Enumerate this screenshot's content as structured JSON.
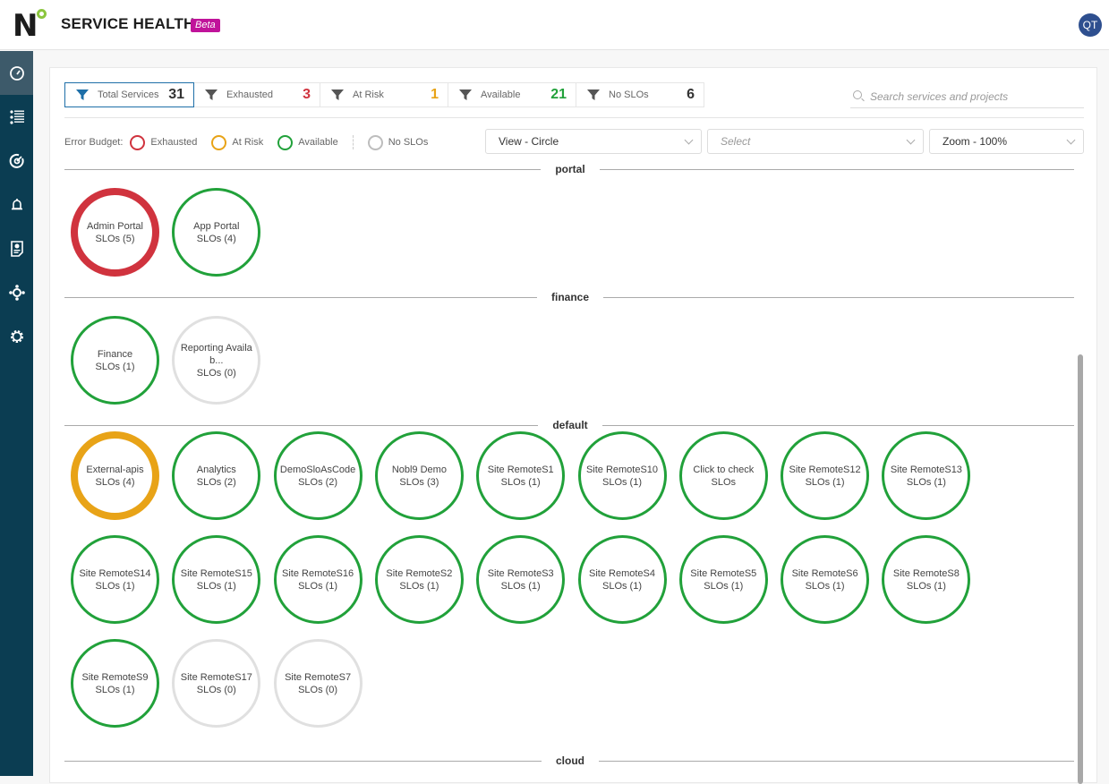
{
  "header": {
    "app_title": "SERVICE HEALTH",
    "badge": "Beta",
    "avatar_initials": "QT"
  },
  "sidebar": {
    "items": [
      {
        "name": "dashboard",
        "icon": "speedometer-icon",
        "active": true
      },
      {
        "name": "catalog",
        "icon": "list-icon",
        "active": false
      },
      {
        "name": "slo",
        "icon": "target-icon",
        "active": false
      },
      {
        "name": "alerts",
        "icon": "bell-icon",
        "active": false
      },
      {
        "name": "reports",
        "icon": "report-icon",
        "active": false
      },
      {
        "name": "integrations",
        "icon": "integrations-icon",
        "active": false
      },
      {
        "name": "settings",
        "icon": "gear-icon",
        "active": false
      }
    ]
  },
  "stats": [
    {
      "label": "Total Services",
      "count": "31",
      "color": "#333333",
      "selected": true
    },
    {
      "label": "Exhausted",
      "count": "3",
      "color": "#d0333e",
      "selected": false
    },
    {
      "label": "At Risk",
      "count": "1",
      "color": "#e8a317",
      "selected": false
    },
    {
      "label": "Available",
      "count": "21",
      "color": "#21a13a",
      "selected": false
    },
    {
      "label": "No SLOs",
      "count": "6",
      "color": "#333333",
      "selected": false
    }
  ],
  "search": {
    "placeholder": "Search services and projects",
    "value": ""
  },
  "legend": {
    "title": "Error Budget:",
    "items": [
      {
        "label": "Exhausted",
        "color": "#d0333e"
      },
      {
        "label": "At Risk",
        "color": "#e8a317"
      },
      {
        "label": "Available",
        "color": "#21a13a"
      },
      {
        "label": "No SLOs",
        "color": "#bdbdbd"
      }
    ]
  },
  "controls": {
    "view": "View - Circle",
    "select_placeholder": "Select",
    "zoom": "Zoom - 100%"
  },
  "status_colors": {
    "exhausted": "#d0333e",
    "at_risk": "#e8a317",
    "available": "#21a13a",
    "none": "#e0e0e0"
  },
  "groups": [
    {
      "name": "portal",
      "services": [
        {
          "name": "Admin Portal",
          "slos": "SLOs (5)",
          "status": "exhausted"
        },
        {
          "name": "App Portal",
          "slos": "SLOs (4)",
          "status": "available"
        }
      ]
    },
    {
      "name": "finance",
      "services": [
        {
          "name": "Finance",
          "slos": "SLOs (1)",
          "status": "available"
        },
        {
          "name": "Reporting Availab...",
          "slos": "SLOs (0)",
          "status": "none"
        }
      ]
    },
    {
      "name": "default",
      "services": [
        {
          "name": "External-apis",
          "slos": "SLOs (4)",
          "status": "at_risk"
        },
        {
          "name": "Analytics",
          "slos": "SLOs (2)",
          "status": "available"
        },
        {
          "name": "DemoSloAsCode",
          "slos": "SLOs (2)",
          "status": "available"
        },
        {
          "name": "Nobl9 Demo",
          "slos": "SLOs (3)",
          "status": "available"
        },
        {
          "name": "Site RemoteS1",
          "slos": "SLOs (1)",
          "status": "available"
        },
        {
          "name": "Site RemoteS10",
          "slos": "SLOs (1)",
          "status": "available"
        },
        {
          "name": "Click to check",
          "slos": "SLOs",
          "status": "available"
        },
        {
          "name": "Site RemoteS12",
          "slos": "SLOs (1)",
          "status": "available"
        },
        {
          "name": "Site RemoteS13",
          "slos": "SLOs (1)",
          "status": "available"
        },
        {
          "name": "Site RemoteS14",
          "slos": "SLOs (1)",
          "status": "available"
        },
        {
          "name": "Site RemoteS15",
          "slos": "SLOs (1)",
          "status": "available"
        },
        {
          "name": "Site RemoteS16",
          "slos": "SLOs (1)",
          "status": "available"
        },
        {
          "name": "Site RemoteS2",
          "slos": "SLOs (1)",
          "status": "available"
        },
        {
          "name": "Site RemoteS3",
          "slos": "SLOs (1)",
          "status": "available"
        },
        {
          "name": "Site RemoteS4",
          "slos": "SLOs (1)",
          "status": "available"
        },
        {
          "name": "Site RemoteS5",
          "slos": "SLOs (1)",
          "status": "available"
        },
        {
          "name": "Site RemoteS6",
          "slos": "SLOs (1)",
          "status": "available"
        },
        {
          "name": "Site RemoteS8",
          "slos": "SLOs (1)",
          "status": "available"
        },
        {
          "name": "Site RemoteS9",
          "slos": "SLOs (1)",
          "status": "available"
        },
        {
          "name": "Site RemoteS17",
          "slos": "SLOs (0)",
          "status": "none"
        },
        {
          "name": "Site RemoteS7",
          "slos": "SLOs (0)",
          "status": "none"
        }
      ]
    },
    {
      "name": "cloud",
      "services": []
    }
  ]
}
